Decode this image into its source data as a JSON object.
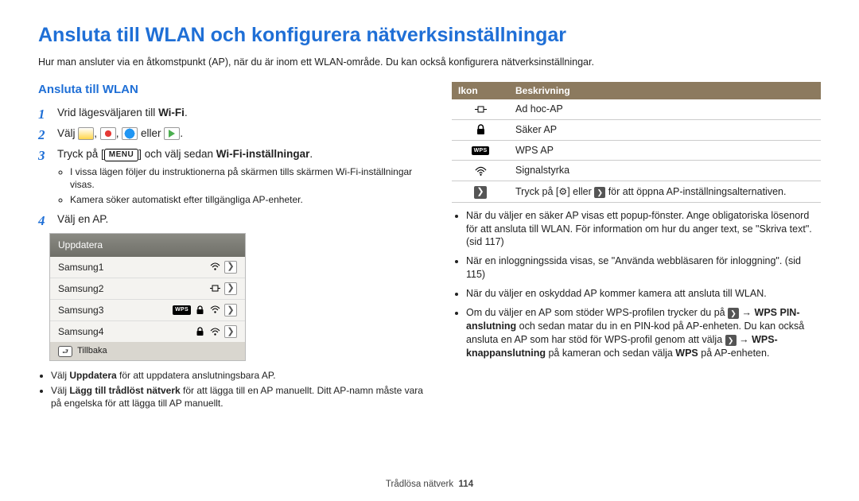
{
  "title": "Ansluta till WLAN och konfigurera nätverksinställningar",
  "intro": "Hur man ansluter via en åtkomstpunkt (AP), när du är inom ett WLAN-område. Du kan också konfigurera nätverksinställningar.",
  "left": {
    "heading": "Ansluta till WLAN",
    "step1_a": "Vrid lägesväljaren till ",
    "step1_b": "Wi-Fi",
    "step1_c": ".",
    "step2_a": "Välj ",
    "step2_b": ", ",
    "step2_c": ", ",
    "step2_d": " eller ",
    "step2_e": ".",
    "step3_a": "Tryck på [",
    "step3_menu": "MENU",
    "step3_b": "] och välj sedan ",
    "step3_bold": "Wi-Fi-inställningar",
    "step3_c": ".",
    "step3_sub1": "I vissa lägen följer du instruktionerna på skärmen tills skärmen Wi-Fi-inställningar visas.",
    "step3_sub2": "Kamera söker automatiskt efter tillgängliga AP-enheter.",
    "step4": "Välj en AP.",
    "apbox": {
      "header": "Uppdatera",
      "rows": [
        "Samsung1",
        "Samsung2",
        "Samsung3",
        "Samsung4"
      ],
      "back": "Tillbaka"
    },
    "post1_a": "Välj ",
    "post1_b": "Uppdatera",
    "post1_c": " för att uppdatera anslutningsbara AP.",
    "post2_a": "Välj ",
    "post2_b": "Lägg till trådlöst nätverk",
    "post2_c": " för att lägga till en AP manuellt. Ditt AP-namn måste vara på engelska för att lägga till AP manuellt."
  },
  "right": {
    "th_icon": "Ikon",
    "th_desc": "Beskrivning",
    "rows": [
      {
        "desc": "Ad hoc-AP"
      },
      {
        "desc": "Säker AP"
      },
      {
        "desc": "WPS AP"
      },
      {
        "desc": "Signalstyrka"
      },
      {
        "desc_a": "Tryck på [",
        "desc_b": "] eller ",
        "desc_c": " för att öppna AP-inställningsalternativen."
      }
    ],
    "bul1": "När du väljer en säker AP visas ett popup-fönster. Ange obligatoriska lösenord för att ansluta till WLAN. För information om hur du anger text, se \"Skriva text\". (sid 117)",
    "bul2": "När en inloggningssida visas, se \"Använda webbläsaren för inloggning\". (sid 115)",
    "bul3": "När du väljer en oskyddad AP kommer kamera att ansluta till WLAN.",
    "bul4_a": "Om du väljer en AP som stöder WPS-profilen trycker du på ",
    "bul4_b": " → ",
    "bul4_c": "WPS PIN-anslutning",
    "bul4_d": " och sedan matar du in en PIN-kod på AP-enheten. Du kan också ansluta en AP som har stöd för WPS-profil genom att välja ",
    "bul4_e": " → ",
    "bul4_f": "WPS-knappanslutning",
    "bul4_g": " på kameran och sedan välja ",
    "bul4_h": "WPS",
    "bul4_i": " på AP-enheten."
  },
  "footer": {
    "label": "Trådlösa nätverk",
    "page": "114"
  }
}
